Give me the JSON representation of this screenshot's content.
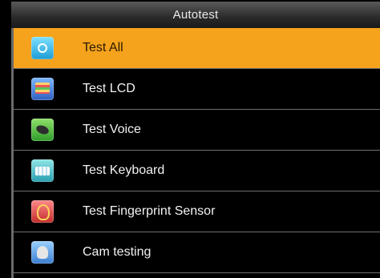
{
  "window": {
    "title": "Autotest"
  },
  "menu": {
    "items": [
      {
        "label": "Test All",
        "icon": "test-all-icon",
        "selected": true
      },
      {
        "label": "Test LCD",
        "icon": "lcd-icon",
        "selected": false
      },
      {
        "label": "Test Voice",
        "icon": "speaker-icon",
        "selected": false
      },
      {
        "label": "Test Keyboard",
        "icon": "keyboard-icon",
        "selected": false
      },
      {
        "label": "Test Fingerprint Sensor",
        "icon": "fingerprint-icon",
        "selected": false
      },
      {
        "label": "Cam testing",
        "icon": "camera-icon",
        "selected": false
      }
    ]
  },
  "colors": {
    "selected_bg": "#f5a31c",
    "background": "#000000",
    "divider": "#6f6f6f"
  }
}
